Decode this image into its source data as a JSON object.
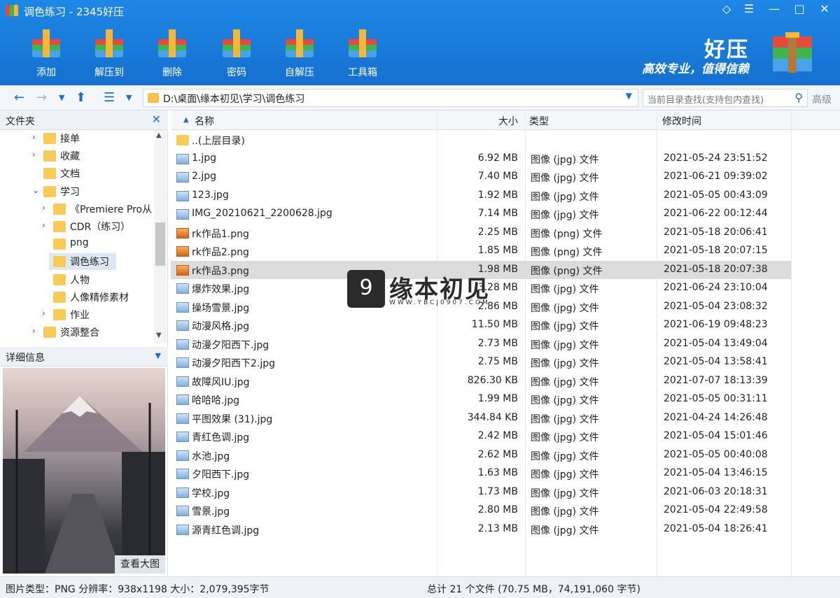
{
  "window": {
    "title": "调色练习 - 2345好压"
  },
  "toolbar": [
    {
      "label": "添加",
      "icon": "add-archive-icon"
    },
    {
      "label": "解压到",
      "icon": "extract-icon"
    },
    {
      "label": "删除",
      "icon": "recycle-bin-icon"
    },
    {
      "label": "密码",
      "icon": "lock-icon"
    },
    {
      "label": "自解压",
      "icon": "self-extract-icon"
    },
    {
      "label": "工具箱",
      "icon": "toolbox-icon"
    }
  ],
  "brand": {
    "name": "好压",
    "slogan": "高效专业，值得信赖"
  },
  "nav": {
    "path": "D:\\桌面\\缘本初见\\学习\\调色练习",
    "search_placeholder": "当前目录查找(支持包内查找)",
    "advanced_label": "高级"
  },
  "left": {
    "folders_title": "文件夹",
    "details_title": "详细信息",
    "view_big_label": "查看大图",
    "tree": [
      {
        "label": "接单",
        "arrow": "›"
      },
      {
        "label": "收藏",
        "arrow": "›"
      },
      {
        "label": "文档",
        "arrow": ""
      },
      {
        "label": "学习",
        "arrow": "⌄"
      },
      {
        "label": "《Premiere Pro从",
        "arrow": "›"
      },
      {
        "label": "CDR（练习）",
        "arrow": "›"
      },
      {
        "label": "png",
        "arrow": ""
      },
      {
        "label": "调色练习",
        "arrow": ""
      },
      {
        "label": "人物",
        "arrow": ""
      },
      {
        "label": "人像精修素材",
        "arrow": ""
      },
      {
        "label": "作业",
        "arrow": "›"
      },
      {
        "label": "资源整合",
        "arrow": "›"
      }
    ]
  },
  "columns": {
    "name": "名称",
    "size": "大小",
    "type": "类型",
    "modified": "修改时间"
  },
  "files": [
    {
      "name": "..(上层目录)",
      "size": "",
      "type": "",
      "modified": "",
      "kind": "folder"
    },
    {
      "name": "1.jpg",
      "size": "6.92 MB",
      "type": "图像 (jpg) 文件",
      "modified": "2021-05-24 23:51:52",
      "kind": "jpg"
    },
    {
      "name": "2.jpg",
      "size": "7.40 MB",
      "type": "图像 (jpg) 文件",
      "modified": "2021-06-21 09:39:02",
      "kind": "jpg"
    },
    {
      "name": "123.jpg",
      "size": "1.92 MB",
      "type": "图像 (jpg) 文件",
      "modified": "2021-05-05 00:43:09",
      "kind": "jpg"
    },
    {
      "name": "IMG_20210621_2200628.jpg",
      "size": "7.14 MB",
      "type": "图像 (jpg) 文件",
      "modified": "2021-06-22 00:12:44",
      "kind": "jpg"
    },
    {
      "name": "rk作品1.png",
      "size": "2.25 MB",
      "type": "图像 (png) 文件",
      "modified": "2021-05-18 20:06:41",
      "kind": "png"
    },
    {
      "name": "rk作品2.png",
      "size": "1.85 MB",
      "type": "图像 (png) 文件",
      "modified": "2021-05-18 20:07:15",
      "kind": "png"
    },
    {
      "name": "rk作品3.png",
      "size": "1.98 MB",
      "type": "图像 (png) 文件",
      "modified": "2021-05-18 20:07:38",
      "kind": "png"
    },
    {
      "name": "爆炸效果.jpg",
      "size": "3.28 MB",
      "type": "图像 (jpg) 文件",
      "modified": "2021-06-24 23:10:04",
      "kind": "jpg"
    },
    {
      "name": "操场雪景.jpg",
      "size": "2.86 MB",
      "type": "图像 (jpg) 文件",
      "modified": "2021-05-04 23:08:32",
      "kind": "jpg"
    },
    {
      "name": "动漫风格.jpg",
      "size": "11.50 MB",
      "type": "图像 (jpg) 文件",
      "modified": "2021-06-19 09:48:23",
      "kind": "jpg"
    },
    {
      "name": "动漫夕阳西下.jpg",
      "size": "2.73 MB",
      "type": "图像 (jpg) 文件",
      "modified": "2021-05-04 13:49:04",
      "kind": "jpg"
    },
    {
      "name": "动漫夕阳西下2.jpg",
      "size": "2.75 MB",
      "type": "图像 (jpg) 文件",
      "modified": "2021-05-04 13:58:41",
      "kind": "jpg"
    },
    {
      "name": "故障风IU.jpg",
      "size": "826.30 KB",
      "type": "图像 (jpg) 文件",
      "modified": "2021-07-07 18:13:39",
      "kind": "jpg"
    },
    {
      "name": "哈哈哈.jpg",
      "size": "1.99 MB",
      "type": "图像 (jpg) 文件",
      "modified": "2021-05-05 00:31:11",
      "kind": "jpg"
    },
    {
      "name": "平图效果 (31).jpg",
      "size": "344.84 KB",
      "type": "图像 (jpg) 文件",
      "modified": "2021-04-24 14:26:48",
      "kind": "jpg"
    },
    {
      "name": "青红色调.jpg",
      "size": "2.42 MB",
      "type": "图像 (jpg) 文件",
      "modified": "2021-05-04 15:01:46",
      "kind": "jpg"
    },
    {
      "name": "水池.jpg",
      "size": "2.62 MB",
      "type": "图像 (jpg) 文件",
      "modified": "2021-05-05 00:40:08",
      "kind": "jpg"
    },
    {
      "name": "夕阳西下.jpg",
      "size": "1.63 MB",
      "type": "图像 (jpg) 文件",
      "modified": "2021-05-04 13:46:15",
      "kind": "jpg"
    },
    {
      "name": "学校.jpg",
      "size": "1.73 MB",
      "type": "图像 (jpg) 文件",
      "modified": "2021-06-03 20:18:31",
      "kind": "jpg"
    },
    {
      "name": "雪景.jpg",
      "size": "2.80 MB",
      "type": "图像 (jpg) 文件",
      "modified": "2021-05-04 22:49:58",
      "kind": "jpg"
    },
    {
      "name": "源青红色调.jpg",
      "size": "2.13 MB",
      "type": "图像 (jpg) 文件",
      "modified": "2021-05-04 18:26:41",
      "kind": "jpg"
    }
  ],
  "selected_index": 7,
  "status": {
    "left": "图片类型：PNG 分辨率：938x1198 大小：2,079,395字节",
    "right": "总计 21 个文件 (70.75 MB，74,191,060 字节)"
  },
  "watermark": {
    "logo_glyph": "9",
    "name": "缘本初见",
    "url": "WWW.YBCJ0907.COM"
  },
  "colors": {
    "accent": "#1b6fd1",
    "folder": "#f8cb58",
    "selected_row": "#dcdcdc"
  }
}
